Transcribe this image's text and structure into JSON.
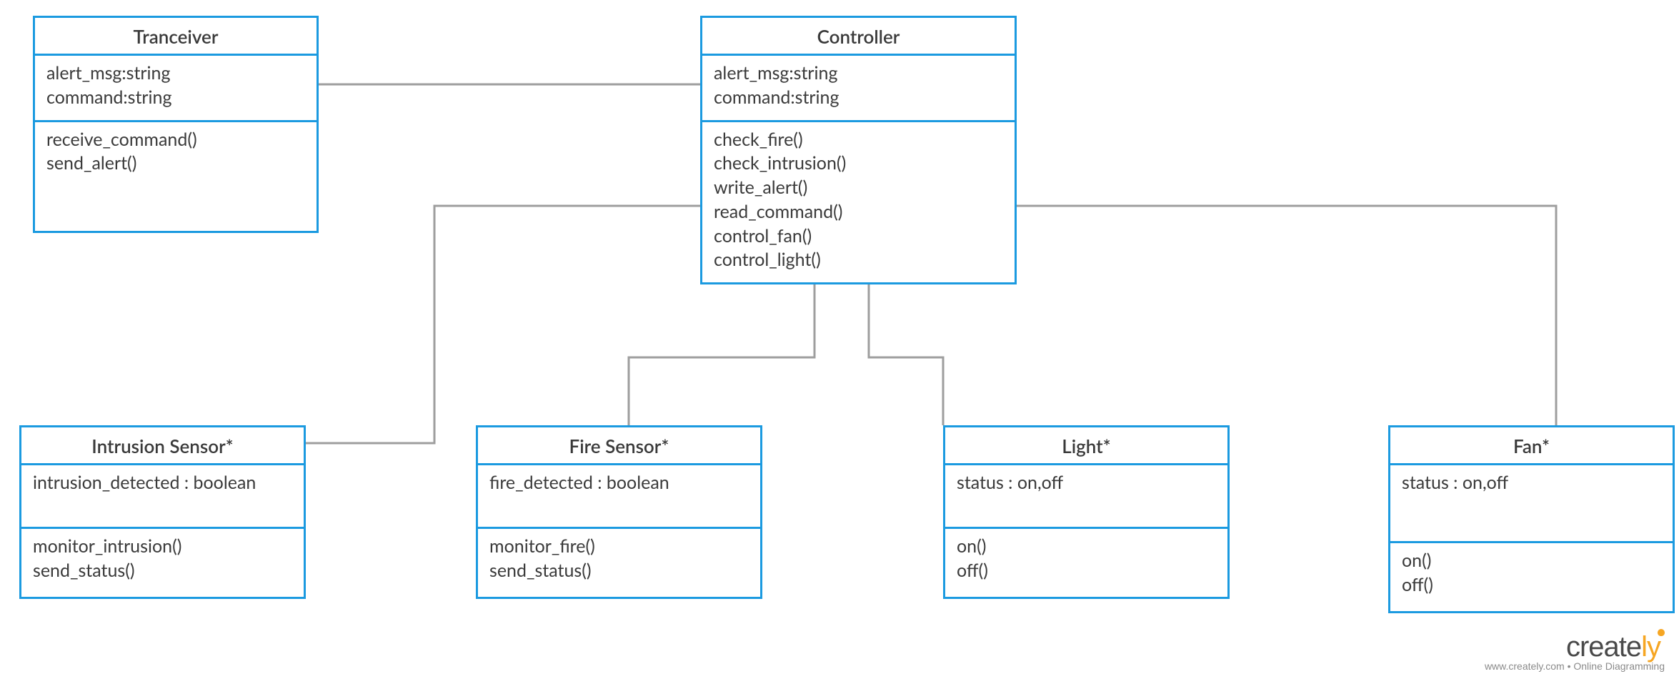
{
  "classes": {
    "tranceiver": {
      "title": "Tranceiver",
      "attrs": [
        "alert_msg:string",
        "command:string"
      ],
      "ops": [
        "receive_command()",
        "send_alert()"
      ]
    },
    "controller": {
      "title": "Controller",
      "attrs": [
        "alert_msg:string",
        "command:string"
      ],
      "ops": [
        "check_fire()",
        "check_intrusion()",
        "write_alert()",
        "read_command()",
        "control_fan()",
        "control_light()"
      ]
    },
    "intrusion": {
      "title": "Intrusion Sensor*",
      "attrs": [
        "intrusion_detected : boolean"
      ],
      "ops": [
        "monitor_intrusion()",
        "send_status()"
      ]
    },
    "fire": {
      "title": "Fire Sensor*",
      "attrs": [
        "fire_detected : boolean"
      ],
      "ops": [
        "monitor_fire()",
        "send_status()"
      ]
    },
    "light": {
      "title": "Light*",
      "attrs": [
        "status : on,off"
      ],
      "ops": [
        "on()",
        "off()"
      ]
    },
    "fan": {
      "title": "Fan*",
      "attrs": [
        "status : on,off"
      ],
      "ops": [
        "on()",
        "off()"
      ]
    }
  },
  "brand": {
    "logo_left": "create",
    "logo_right": "ly",
    "sub": "www.creately.com • Online Diagramming"
  },
  "colors": {
    "border": "#1b9ae0",
    "connector": "#9e9e9e"
  }
}
